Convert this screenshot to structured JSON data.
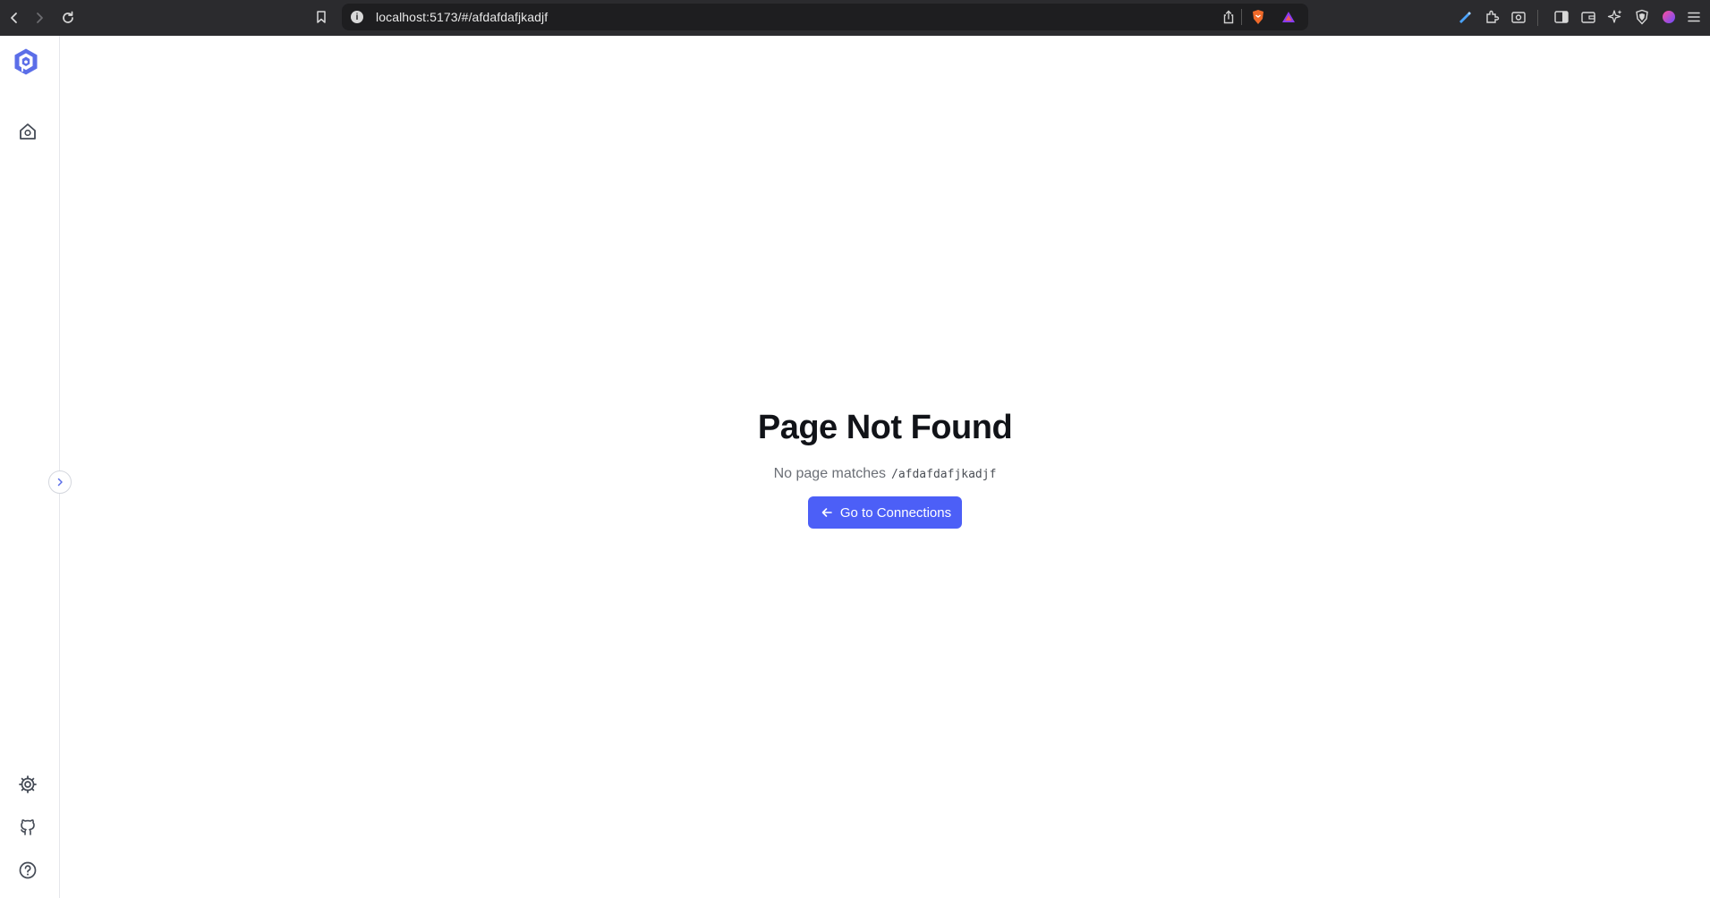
{
  "browser": {
    "url": "localhost:5173/#/afdafdafjkadjf",
    "icons": [
      "back-icon",
      "forward-icon",
      "reload-icon",
      "bookmark-icon",
      "site-info-icon",
      "share-icon",
      "brave-shield-icon",
      "brave-rewards-icon",
      "pen-icon",
      "extensions-icon",
      "screenshot-icon",
      "sidebar-icon",
      "wallet-icon",
      "leo-ai-icon",
      "vpn-icon",
      "profile-icon",
      "menu-icon"
    ]
  },
  "sidebar": {
    "icons": [
      "logo-icon",
      "home-icon",
      "settings-icon",
      "github-icon",
      "help-icon",
      "chevron-right-icon"
    ]
  },
  "not_found": {
    "title": "Page Not Found",
    "message": "No page matches",
    "path": "/afdafdafjkadjf",
    "button_label": "Go to Connections"
  },
  "colors": {
    "accent": "#4c5ff7",
    "logo": "#5b6ee8",
    "chrome_bg": "#2b2b2e"
  }
}
